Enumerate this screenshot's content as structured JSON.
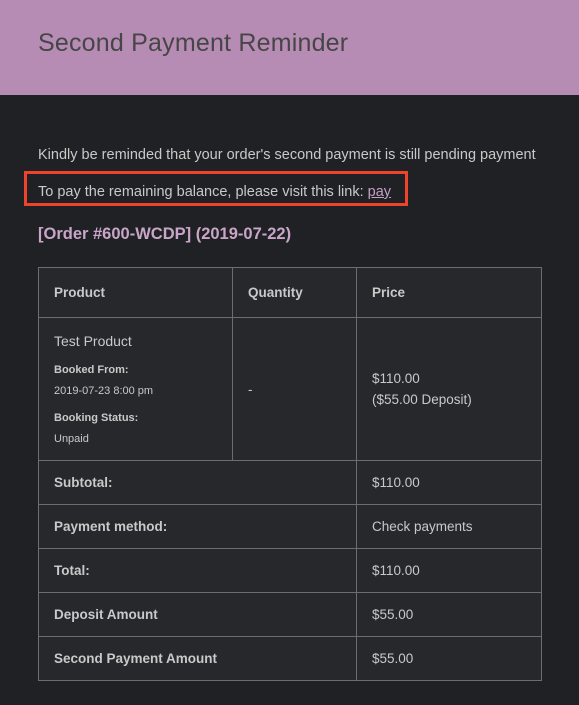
{
  "header": {
    "title": "Second Payment Reminder",
    "background_color": "#b68cb4",
    "title_color": "#464646"
  },
  "body": {
    "intro_text": "Kindly be reminded that your order's second payment is still pending payment",
    "link_line_prefix": "To pay the remaining balance, please visit this link: ",
    "link_label": "pay",
    "link_color": "#c3a0c3",
    "highlight_border_color": "#f0432c",
    "order_heading": "[Order #600-WCDP] (2019-07-22)",
    "order_heading_color": "#c9a5c8"
  },
  "table": {
    "columns": [
      "Product",
      "Quantity",
      "Price"
    ],
    "item": {
      "product_name": "Test Product",
      "booked_from_label": "Booked From:",
      "booked_from_value": "2019-07-23 8:00 pm",
      "booking_status_label": "Booking Status:",
      "booking_status_value": "Unpaid",
      "quantity": "-",
      "price_main": "$110.00",
      "price_note": "($55.00 Deposit)"
    },
    "summary": [
      {
        "label": "Subtotal:",
        "value": "$110.00"
      },
      {
        "label": "Payment method:",
        "value": "Check payments"
      },
      {
        "label": "Total:",
        "value": "$110.00"
      },
      {
        "label": "Deposit Amount",
        "value": "$55.00"
      },
      {
        "label": "Second Payment Amount",
        "value": "$55.00"
      }
    ]
  }
}
